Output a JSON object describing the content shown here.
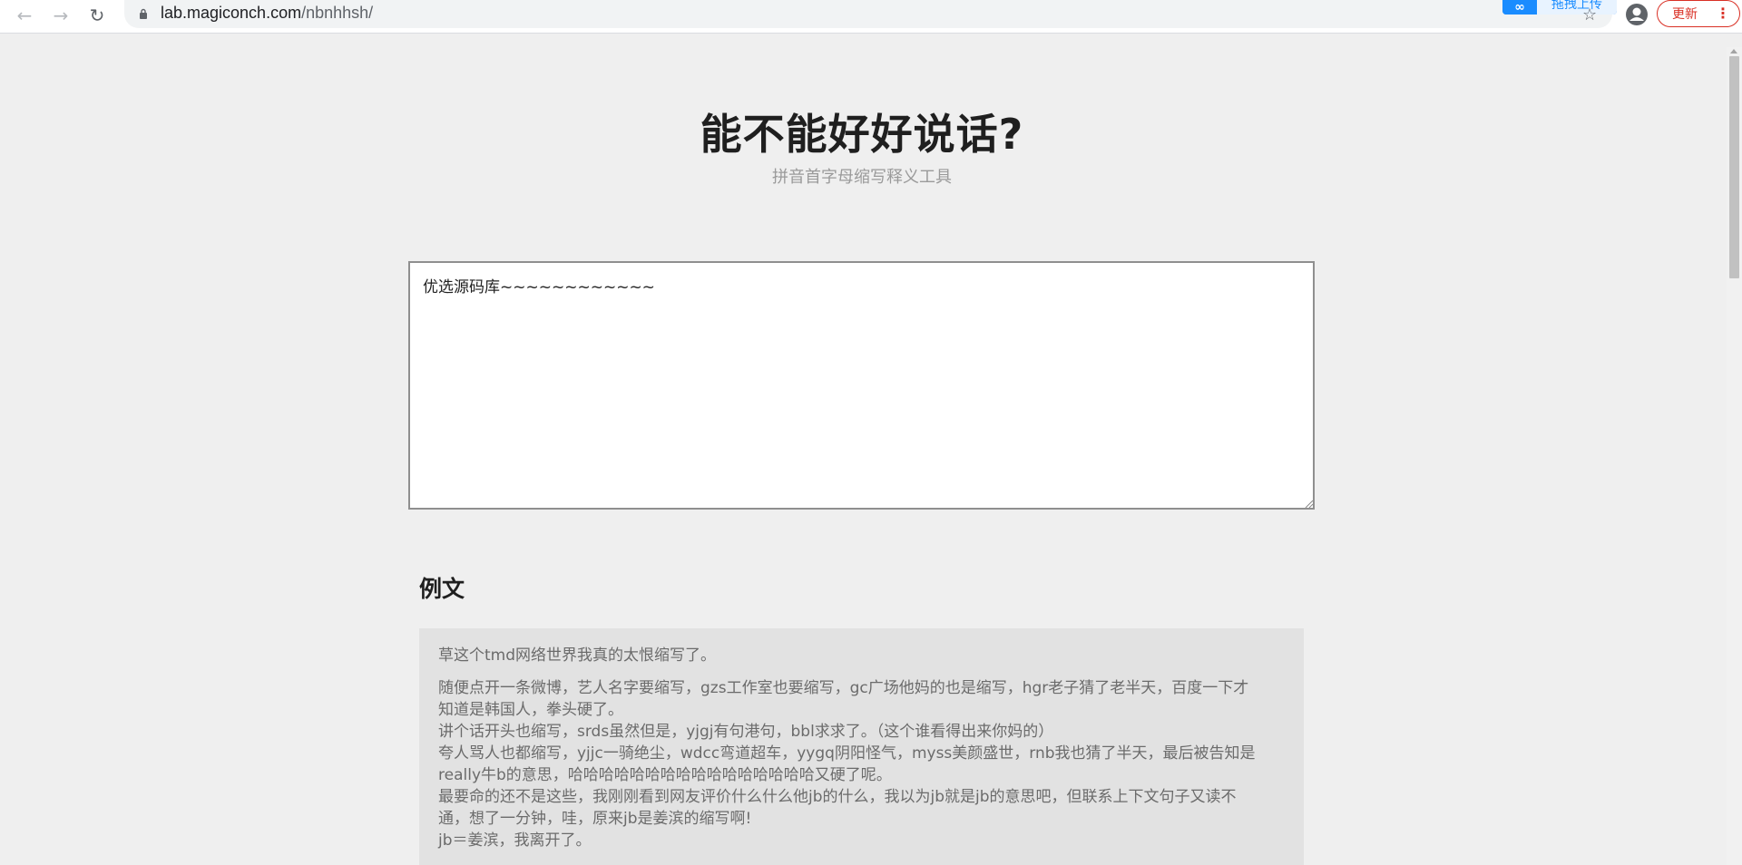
{
  "browser": {
    "url_host": "lab.magiconch.com",
    "url_path": "/nbnhhsh/",
    "extension_label": "拖拽上传",
    "update_label": "更新"
  },
  "page": {
    "title": "能不能好好说话?",
    "subtitle": "拼音首字母缩写释义工具"
  },
  "input": {
    "value": "优选源码库~~~~~~~~~~~~"
  },
  "example": {
    "heading": "例文",
    "first_paragraph": "草这个tmd网络世界我真的太恨缩写了。",
    "lines": [
      "随便点开一条微博，艺人名字要缩写，gzs工作室也要缩写，gc广场他妈的也是缩写，hgr老子猜了老半天，百度一下才",
      "知道是韩国人，拳头硬了。",
      "讲个话开头也缩写，srds虽然但是，yjgj有句港句，bbl求求了。（这个谁看得出来你妈的）",
      "夸人骂人也都缩写，yjjc一骑绝尘，wdcc弯道超车，yygq阴阳怪气，myss美颜盛世，rnb我也猜了半天，最后被告知是",
      "really牛b的意思，哈哈哈哈哈哈哈哈哈哈哈哈哈哈哈哈又硬了呢。",
      "最要命的还不是这些，我刚刚看到网友评价什么什么他jb的什么，我以为jb就是jb的意思吧，但联系上下文句子又读不",
      "通，想了一分钟，哇，原来jb是姜滨的缩写啊!",
      "jb＝姜滨，我离开了。"
    ]
  },
  "colors": {
    "page_bg": "#efefef",
    "example_bg": "#e2e2e2",
    "update_red": "#d93025",
    "extension_blue": "#1a8cff"
  }
}
